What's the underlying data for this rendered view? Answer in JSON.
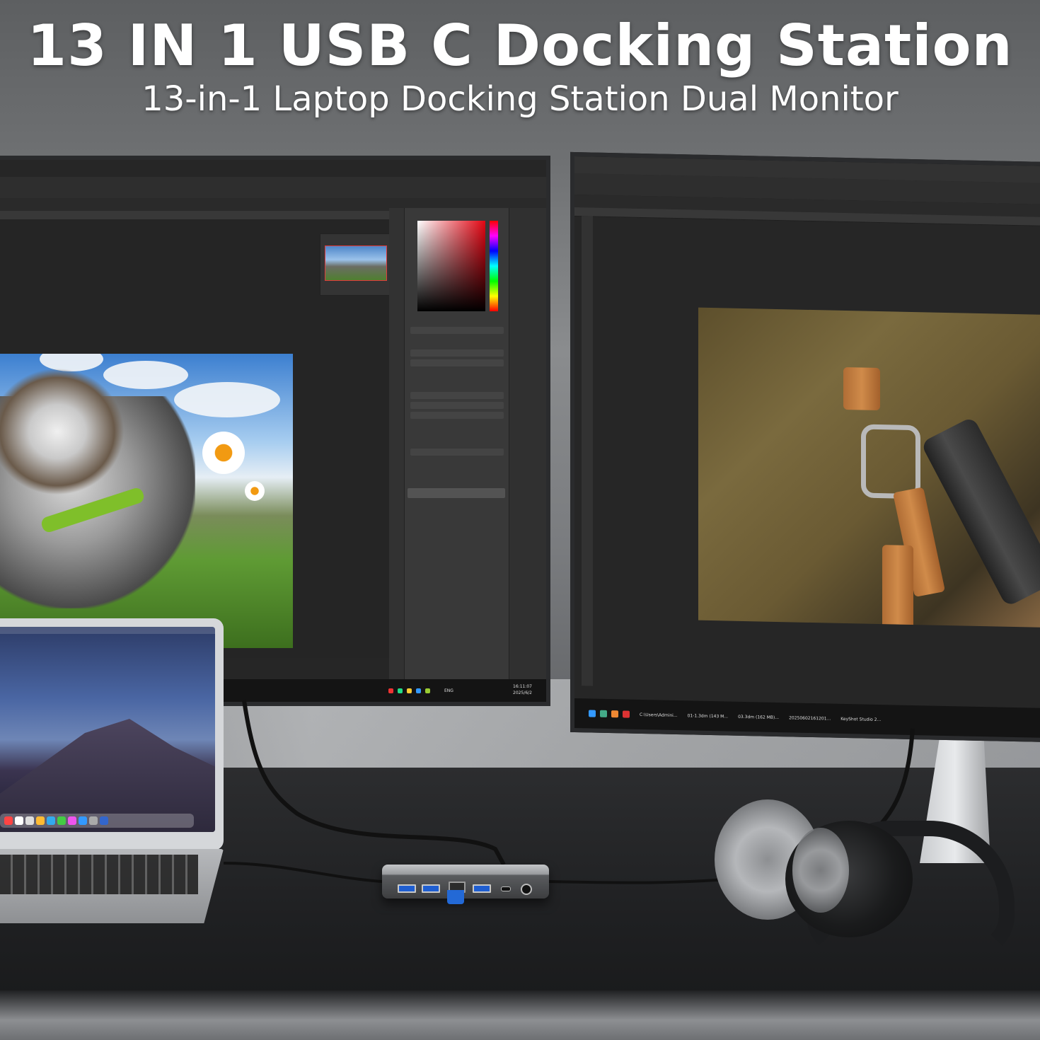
{
  "headline": "13 IN 1 USB C Docking Station",
  "subheadline": "13-in-1 Laptop Docking Station Dual Monitor",
  "left_monitor": {
    "image": "australian-shepherd-dog-photo",
    "taskbar_clock_time": "16:11:07",
    "taskbar_clock_date": "2025/6/2",
    "taskbar_lang": "ENG"
  },
  "right_monitor": {
    "image": "backpack-with-bottle-photo",
    "taskbar_items": [
      "C:\\Users\\Admini...",
      "01-1.3dm (143 M...",
      "03.3dm (162 MB)...",
      "20250602161201...",
      "KeyShot Studio 2..."
    ]
  },
  "hub_ports": [
    "usb-a",
    "usb-a",
    "ethernet",
    "usb-a",
    "usb-c",
    "audio"
  ],
  "colors": {
    "title_text": "#ffffff",
    "hub_accent": "#2369d6",
    "photoshop_bg": "#262626"
  }
}
